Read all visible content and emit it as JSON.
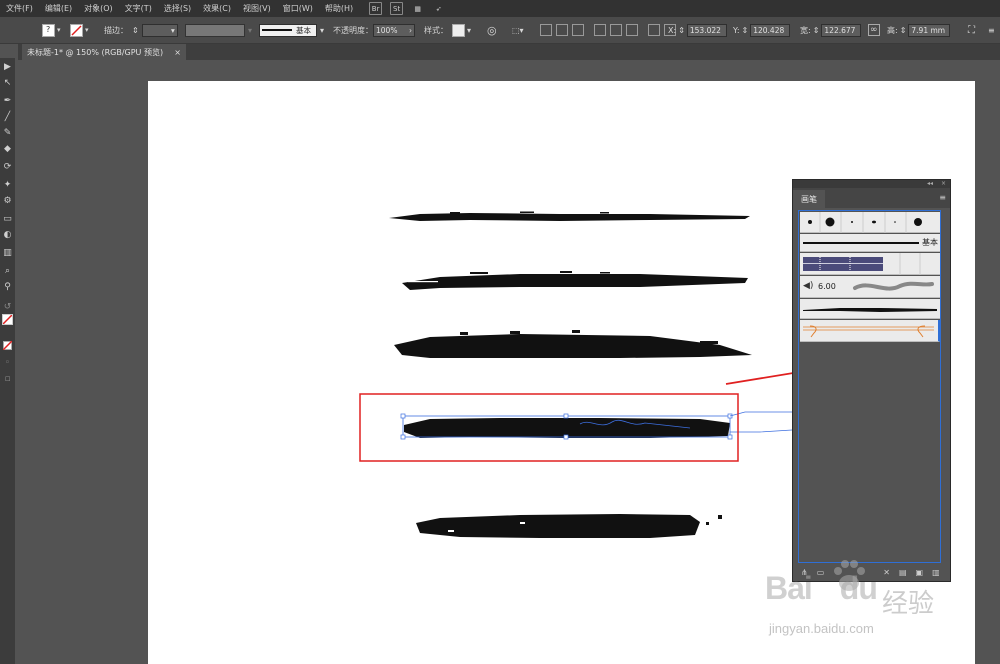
{
  "menubar": {
    "items": [
      "文件(F)",
      "编辑(E)",
      "对象(O)",
      "文字(T)",
      "选择(S)",
      "效果(C)",
      "视图(V)",
      "窗口(W)",
      "帮助(H)"
    ],
    "bridge_label": "Br",
    "stock_label": "St"
  },
  "control": {
    "stroke_label": "描边：",
    "brush_label": "基本",
    "opacity_label": "不透明度：",
    "opacity_value": "100%",
    "style_label": "样式：",
    "x_label": "X:",
    "x_value": "153.022",
    "y_label": "Y:",
    "y_value": "120.428",
    "w_label": "宽:",
    "w_value": "122.677",
    "h_label": "高:",
    "h_value": "7.91 mm"
  },
  "document": {
    "tab_title": "未标题-1* @ 150% (RGB/GPU 预览)",
    "close_symbol": "×"
  },
  "brush_panel": {
    "title": "画笔",
    "basic_label": "基本",
    "size_value": "6.00",
    "collapse_symbol": "◂◂",
    "close_symbol": "×"
  },
  "watermark": {
    "logo_text": "Bai",
    "logo_text2": "du",
    "site_label": "经验",
    "url": "jingyan.baidu.com"
  },
  "colors": {
    "selection": "#3d6fe0",
    "highlight_box": "#e02020",
    "arrow": "#e02020"
  }
}
